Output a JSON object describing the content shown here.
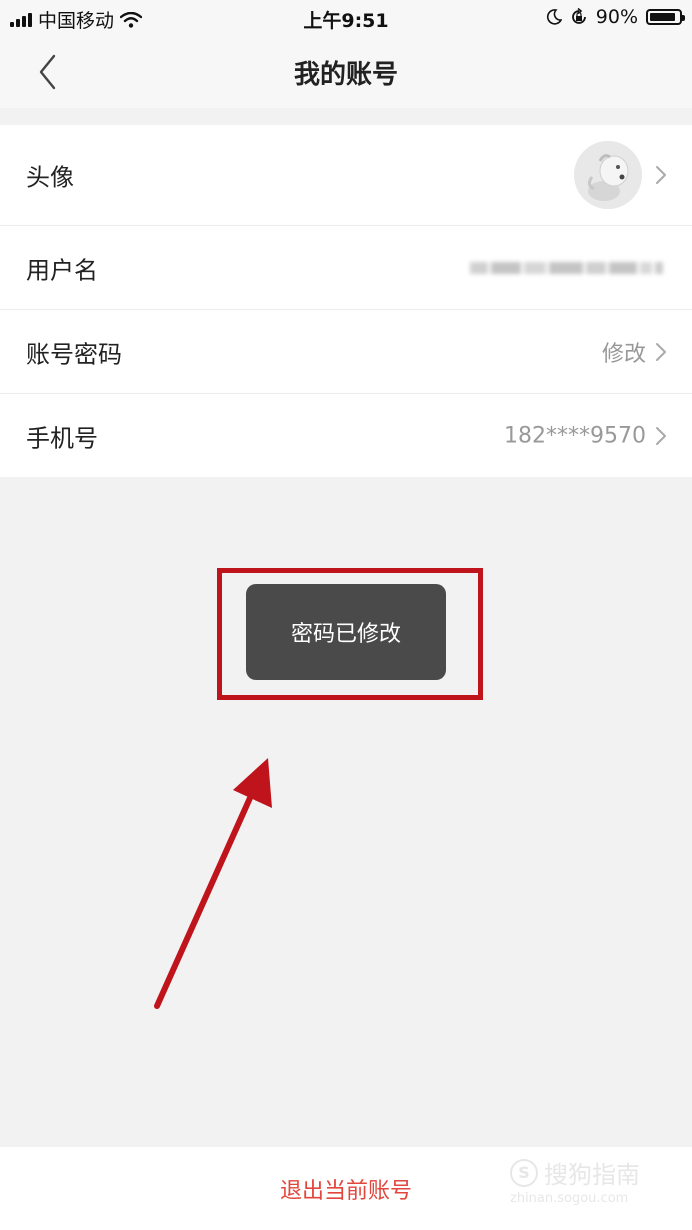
{
  "status_bar": {
    "carrier": "中国移动",
    "time": "上午9:51",
    "battery_text": "90%",
    "battery_level": 0.9,
    "icons": [
      "signal-icon",
      "wifi-icon",
      "moon-icon",
      "rotation-lock-icon",
      "battery-icon"
    ]
  },
  "nav": {
    "title": "我的账号",
    "back_icon": "chevron-left-icon"
  },
  "rows": [
    {
      "label": "头像",
      "value": ""
    },
    {
      "label": "用户名",
      "value": ""
    },
    {
      "label": "账号密码",
      "value": "修改"
    },
    {
      "label": "手机号",
      "value": "182****9570"
    }
  ],
  "toast": {
    "text": "密码已修改"
  },
  "annotation": {
    "frame_color": "#c0141c",
    "arrow_color": "#c0141c"
  },
  "footer": {
    "logout_label": "退出当前账号",
    "logout_color": "#e2463c"
  },
  "watermark": {
    "text": "搜狗指南",
    "badge": "S",
    "url": "zhinan.sogou.com"
  }
}
